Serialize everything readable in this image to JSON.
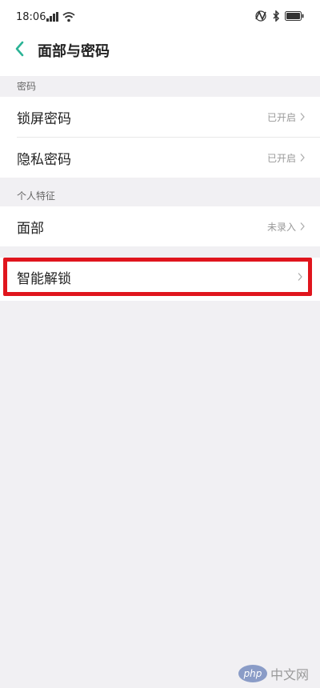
{
  "status": {
    "time": "18:06",
    "icons": [
      "signal-icon",
      "wifi-icon",
      "nfc-icon",
      "bluetooth-icon",
      "battery-icon"
    ]
  },
  "header": {
    "title": "面部与密码",
    "back_icon": "back-arrow-icon"
  },
  "sections": [
    {
      "header": "密码",
      "rows": [
        {
          "label": "锁屏密码",
          "value": "已开启"
        },
        {
          "label": "隐私密码",
          "value": "已开启"
        }
      ]
    },
    {
      "header": "个人特征",
      "rows": [
        {
          "label": "面部",
          "value": "未录入"
        }
      ]
    }
  ],
  "smart_unlock": {
    "label": "智能解锁"
  },
  "watermark": {
    "logo": "php",
    "site": "中文网"
  },
  "colors": {
    "accent": "#2bb396",
    "highlight": "#e0151d"
  }
}
